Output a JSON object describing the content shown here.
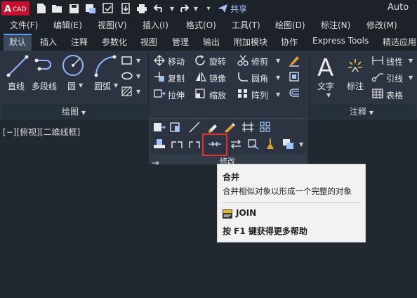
{
  "titlebar": {
    "logo_text": "CAD",
    "share_label": "共享",
    "app_title": "Auto"
  },
  "menubar": {
    "items": [
      "文件(F)",
      "编辑(E)",
      "视图(V)",
      "插入(I)",
      "格式(O)",
      "工具(T)",
      "绘图(D)",
      "标注(N)",
      "修改(M)"
    ]
  },
  "tabs": {
    "items": [
      "默认",
      "插入",
      "注释",
      "参数化",
      "视图",
      "管理",
      "输出",
      "附加模块",
      "协作",
      "Express Tools",
      "精选应用"
    ],
    "active": "默认"
  },
  "ribbon": {
    "draw": {
      "label": "绘图",
      "tools": [
        "直线",
        "多段线",
        "圆",
        "圆弧"
      ]
    },
    "modify": {
      "label": "修改",
      "tools": [
        "移动",
        "旋转",
        "修剪",
        "复制",
        "镜像",
        "圆角",
        "拉伸",
        "缩放",
        "阵列"
      ]
    },
    "annotation": {
      "label": "注释",
      "tools": [
        "文字",
        "标注",
        "线性",
        "引线",
        "表格"
      ]
    }
  },
  "viewport": {
    "label": "[−][俯视][二维线框]"
  },
  "tooltip": {
    "title": "合并",
    "description": "合并相似对象以形成一个完整的对象",
    "command": "JOIN",
    "help": "按 F1 键获得更多帮助"
  },
  "colors": {
    "accent": "#5aa0ff",
    "highlight": "#e5332a",
    "logo_red": "#c8102e"
  }
}
